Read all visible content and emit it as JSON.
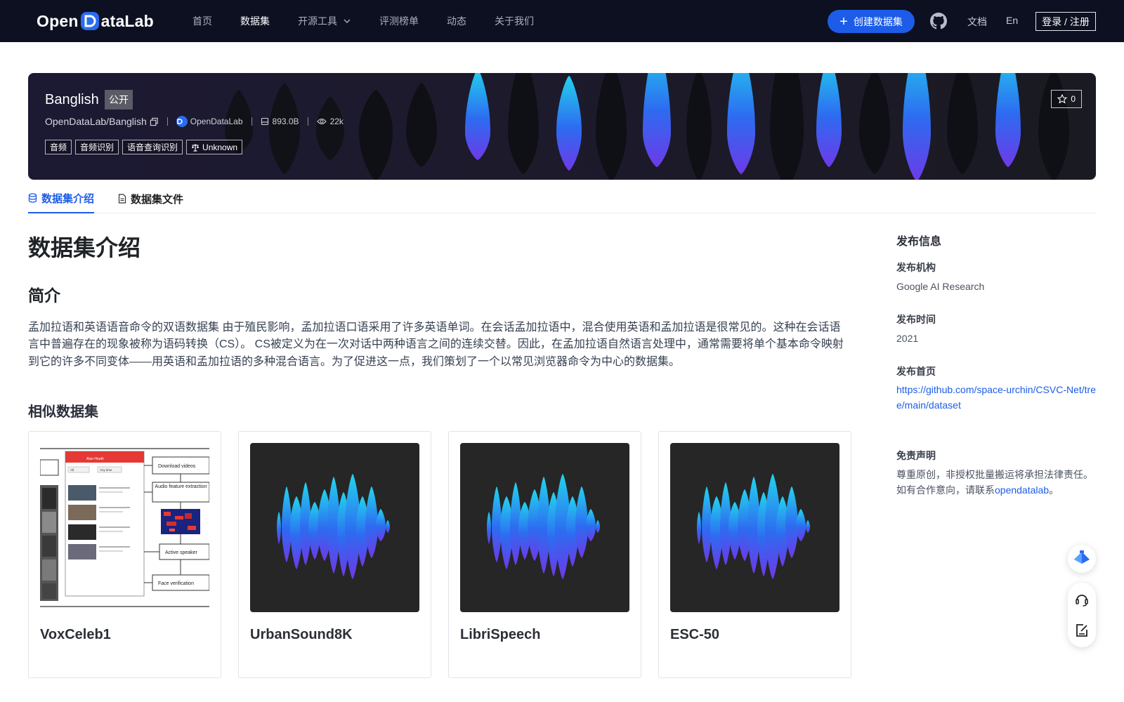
{
  "nav": {
    "logo_text_left": "Open",
    "logo_text_right": "ataLab",
    "links": [
      "首页",
      "数据集",
      "开源工具",
      "评测榜单",
      "动态",
      "关于我们"
    ],
    "active_index": 1,
    "create_button": "创建数据集",
    "docs": "文档",
    "lang": "En",
    "login": "登录 / 注册"
  },
  "dataset": {
    "name": "Banglish",
    "visibility": "公开",
    "repo": "OpenDataLab/Banglish",
    "org": "OpenDataLab",
    "size": "893.0B",
    "views": "22k",
    "tags": [
      "音频",
      "音频识别",
      "语音查询识别"
    ],
    "license": "Unknown",
    "stars": "0"
  },
  "tabs": [
    "数据集介绍",
    "数据集文件"
  ],
  "main": {
    "heading": "数据集介绍",
    "subheading": "简介",
    "description": "孟加拉语和英语语音命令的双语数据集 由于殖民影响，孟加拉语口语采用了许多英语单词。在会话孟加拉语中，混合使用英语和孟加拉语是很常见的。这种在会话语言中普遍存在的现象被称为语码转换（CS）。 CS被定义为在一次对话中两种语言之间的连续交替。因此，在孟加拉语自然语言处理中，通常需要将单个基本命令映射到它的许多不同变体——用英语和孟加拉语的多种混合语言。为了促进这一点，我们策划了一个以常见浏览器命令为中心的数据集。",
    "similar_title": "相似数据集",
    "similar": [
      {
        "title": "VoxCeleb1",
        "thumb": "diagram"
      },
      {
        "title": "UrbanSound8K",
        "thumb": "waveform"
      },
      {
        "title": "LibriSpeech",
        "thumb": "waveform"
      },
      {
        "title": "ESC-50",
        "thumb": "waveform"
      }
    ],
    "vox_diagram": {
      "video_title": "Alan Heath",
      "filter_all": "All",
      "filter_sort": "Any time",
      "download": "Download videos",
      "audio_feature": "Audio feature extraction",
      "active_speaker": "Active speaker",
      "face_verification": "Face verification"
    }
  },
  "sidebar": {
    "title": "发布信息",
    "org_label": "发布机构",
    "org_value": "Google AI Research",
    "time_label": "发布时间",
    "time_value": "2021",
    "home_label": "发布首页",
    "home_url": "https://github.com/space-urchin/CSVC-Net/tree/main/dataset",
    "disclaimer_label": "免责声明",
    "disclaimer_text": "尊重原创，非授权批量搬运将承担法律责任。如有合作意向，请联系",
    "disclaimer_link": "opendatalab",
    "disclaimer_end": "。"
  },
  "colors": {
    "nav_bg": "#0d1021",
    "accent": "#1d5ce8",
    "wave_cyan": "#22d3ee",
    "wave_purple": "#7c3aed"
  },
  "icons": [
    "github-icon",
    "copy-icon",
    "database-icon",
    "eye-icon",
    "scale-icon",
    "star-icon",
    "file-icon",
    "headset-icon",
    "edit-icon"
  ]
}
